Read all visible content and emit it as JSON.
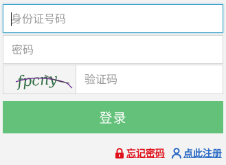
{
  "form": {
    "id_placeholder": "身份证号码",
    "password_placeholder": "密码",
    "captcha_placeholder": "验证码",
    "captcha_text": "fpcny",
    "login_label": "登录"
  },
  "links": {
    "forgot_label": "忘记密码",
    "forgot_icon": "lock-icon",
    "register_label": "点此注册",
    "register_icon": "user-icon"
  },
  "colors": {
    "focus_border": "#3aa0c8",
    "login_button": "#63c17a",
    "forgot_link": "#e0101a",
    "register_link": "#2566c4"
  }
}
